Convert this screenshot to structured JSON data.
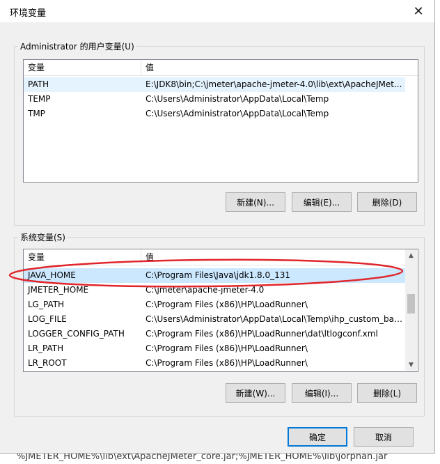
{
  "window": {
    "title": "环境变量",
    "close_glyph": "✕"
  },
  "user_vars": {
    "group_label": "Administrator 的用户变量(U)",
    "columns": [
      "变量",
      "值"
    ],
    "rows": [
      {
        "name": "PATH",
        "value": "E:\\JDK8\\bin;C:\\jmeter\\apache-jmeter-4.0\\lib\\ext\\ApacheJMet..."
      },
      {
        "name": "TEMP",
        "value": "C:\\Users\\Administrator\\AppData\\Local\\Temp"
      },
      {
        "name": "TMP",
        "value": "C:\\Users\\Administrator\\AppData\\Local\\Temp"
      }
    ],
    "buttons": {
      "new": "新建(N)...",
      "edit": "编辑(E)...",
      "delete": "删除(D)"
    }
  },
  "system_vars": {
    "group_label": "系统变量(S)",
    "columns": [
      "变量",
      "值"
    ],
    "rows": [
      {
        "name": "JAVA_HOME",
        "value": "C:\\Program Files\\Java\\jdk1.8.0_131"
      },
      {
        "name": "JMETER_HOME",
        "value": "C:\\jmeter\\apache-jmeter-4.0"
      },
      {
        "name": "LG_PATH",
        "value": "C:\\Program Files (x86)\\HP\\LoadRunner\\"
      },
      {
        "name": "LOG_FILE",
        "value": "C:\\Users\\Administrator\\AppData\\Local\\Temp\\ihp_custom_bat..."
      },
      {
        "name": "LOGGER_CONFIG_PATH",
        "value": "C:\\Program Files (x86)\\HP\\LoadRunner\\dat\\ltlogconf.xml"
      },
      {
        "name": "LR_PATH",
        "value": "C:\\Program Files (x86)\\HP\\LoadRunner\\"
      },
      {
        "name": "LR_ROOT",
        "value": "C:\\Program Files (x86)\\HP\\LoadRunner\\"
      }
    ],
    "buttons": {
      "new": "新建(W)...",
      "edit": "编辑(I)...",
      "delete": "删除(L)"
    }
  },
  "footer": {
    "ok": "确定",
    "cancel": "取消"
  },
  "background_text": "%JMETER_HOME%\\lib\\ext\\ApacheJMeter_core.jar;%JMETER_HOME%\\lib\\jorphan.jar",
  "colors": {
    "selection": "#cce8ff",
    "hover": "#e5f3ff",
    "annotation": "#e0252b",
    "primary_border": "#0078d7"
  },
  "icons": {
    "close": "close-icon",
    "scroll_up": "chevron-up-icon",
    "scroll_down": "chevron-down-icon"
  }
}
